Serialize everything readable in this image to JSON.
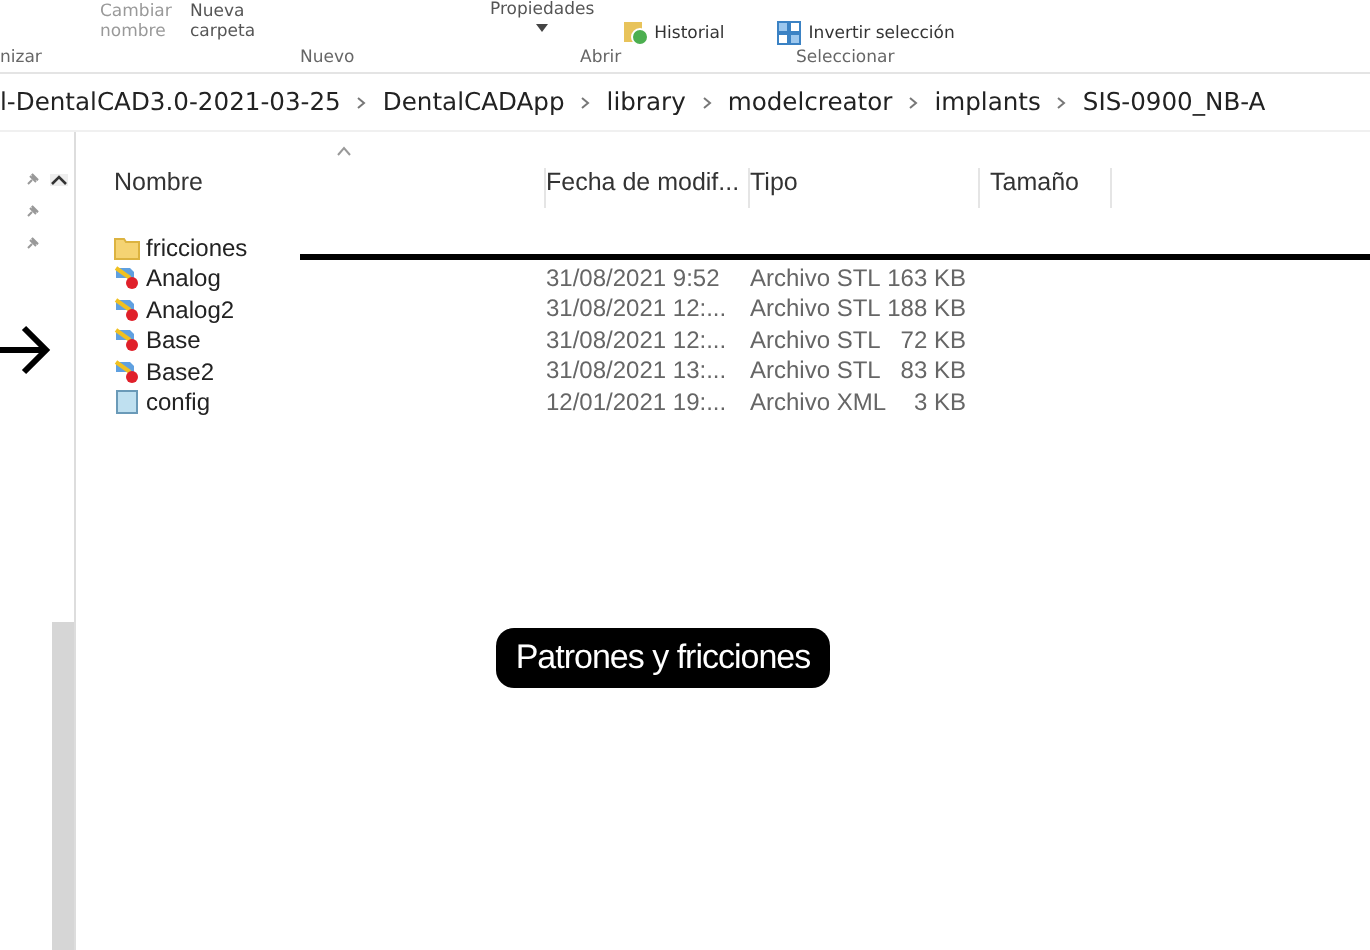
{
  "ribbon": {
    "buttons": [
      {
        "kind": "text",
        "label": "Cambiar nombre"
      },
      {
        "kind": "text",
        "label": "Nueva carpeta"
      },
      {
        "kind": "dropdown",
        "label": "Propiedades"
      },
      {
        "kind": "history",
        "label": "Historial"
      },
      {
        "kind": "invert",
        "label": "Invertir selección"
      }
    ],
    "groups": [
      "nizar",
      "Nuevo",
      "Abrir",
      "Seleccionar"
    ]
  },
  "breadcrumb": [
    "l-DentalCAD3.0-2021-03-25",
    "DentalCADApp",
    "library",
    "modelcreator",
    "implants",
    "SIS-0900_NB-A"
  ],
  "columns": [
    "Nombre",
    "Fecha de modif...",
    "Tipo",
    "Tamaño"
  ],
  "rows": [
    {
      "kind": "folder",
      "name": "fricciones"
    },
    {
      "kind": "stl",
      "name": "Analog",
      "date": "31/08/2021 9:52",
      "type": "Archivo STL",
      "size": "163 KB"
    },
    {
      "kind": "stl",
      "name": "Analog2",
      "date": "31/08/2021 12:...",
      "type": "Archivo STL",
      "size": "188 KB"
    },
    {
      "kind": "stl",
      "name": "Base",
      "date": "31/08/2021 12:...",
      "type": "Archivo STL",
      "size": "72 KB"
    },
    {
      "kind": "stl",
      "name": "Base2",
      "date": "31/08/2021 13:...",
      "type": "Archivo STL",
      "size": "83 KB"
    },
    {
      "kind": "xml",
      "name": "config",
      "date": "12/01/2021 19:...",
      "type": "Archivo XML",
      "size": "3 KB"
    }
  ],
  "callout": {
    "label": "Patrones y fricciones"
  }
}
